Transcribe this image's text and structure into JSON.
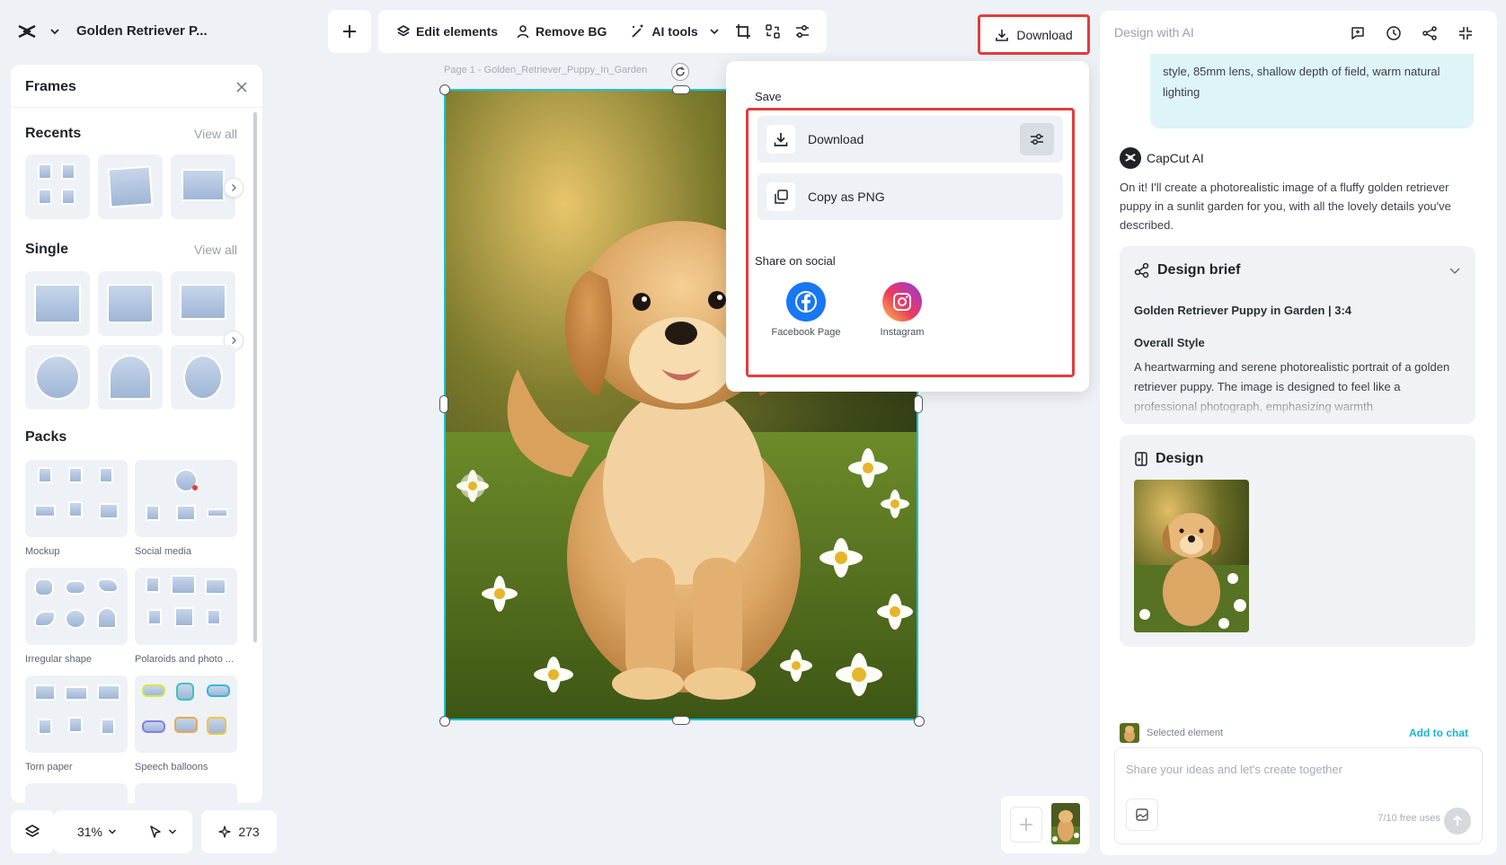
{
  "header": {
    "project_title": "Golden Retriever P...",
    "download_label": "Download"
  },
  "toolbar": {
    "edit_elements": "Edit elements",
    "remove_bg": "Remove BG",
    "ai_tools": "AI tools"
  },
  "frames_panel": {
    "title": "Frames",
    "recents": "Recents",
    "single": "Single",
    "packs": "Packs",
    "view_all": "View all",
    "pack_labels": [
      "Mockup",
      "Social media",
      "Irregular shape",
      "Polaroids and photo ...",
      "Torn paper",
      "Speech balloons"
    ]
  },
  "bottom_bar": {
    "zoom": "31%",
    "credits": "273"
  },
  "canvas": {
    "page_label": "Page 1 -  Golden_Retriever_Puppy_In_Garden"
  },
  "download_popup": {
    "save_label": "Save",
    "download": "Download",
    "copy_png": "Copy as PNG",
    "share_label": "Share on social",
    "facebook": "Facebook Page",
    "instagram": "Instagram"
  },
  "ai_panel": {
    "title": "Design with AI",
    "user_prompt": "style, 85mm lens, shallow depth of field, warm natural lighting",
    "ai_name": "CapCut AI",
    "ai_message": "On it! I'll create a photorealistic image of a fluffy golden retriever puppy in a sunlit garden for you, with all the lovely details you've described.",
    "brief_title": "Design brief",
    "brief_subtitle": "Golden Retriever Puppy in Garden | 3:4",
    "overall_style_label": "Overall Style",
    "overall_style_text": "A heartwarming and serene photorealistic portrait of a golden retriever puppy. The image is designed to feel like a professional photograph, emphasizing warmth",
    "design_title": "Design",
    "selected_element": "Selected element",
    "add_to_chat": "Add to chat",
    "input_placeholder": "Share your ideas and let's create together",
    "free_uses": "7/10 free uses"
  },
  "colors": {
    "accent_cyan": "#18c3d6",
    "highlight_red": "#e23d3d",
    "facebook_blue": "#1877f2"
  }
}
